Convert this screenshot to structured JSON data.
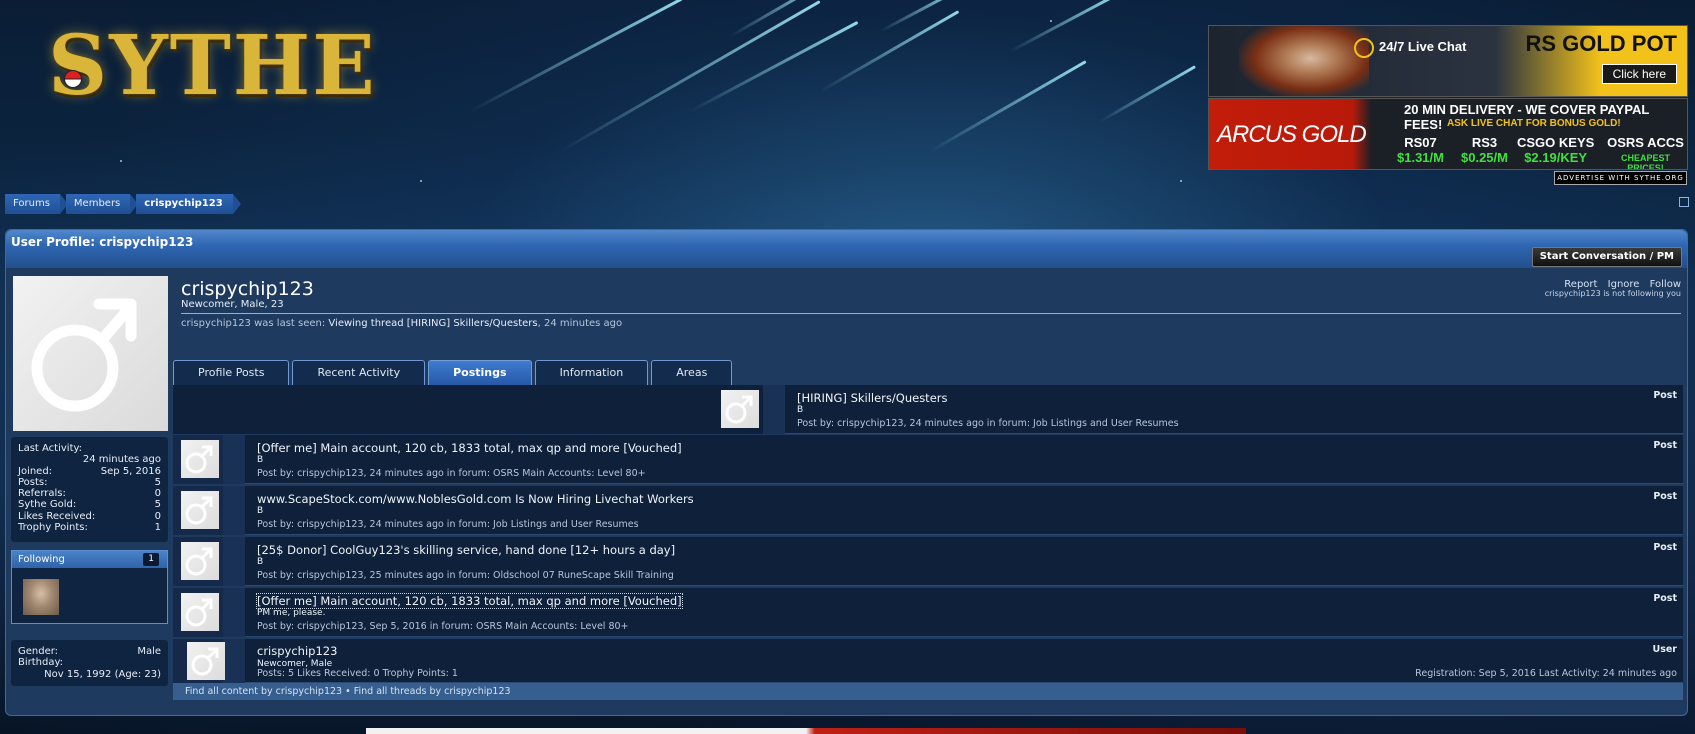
{
  "site": {
    "logo": "SYTHE"
  },
  "ads": {
    "top": {
      "livechat": "24/7 Live Chat",
      "brand": "RS GOLD POT",
      "cta": "Click here"
    },
    "mid": {
      "brand": "ARCUS GOLD",
      "headline": "20 MIN DELIVERY - WE COVER PAYPAL FEES!",
      "sub": "ASK LIVE CHAT FOR BONUS GOLD!",
      "items": [
        {
          "name": "RS07",
          "price": "$1.31/M"
        },
        {
          "name": "RS3",
          "price": "$0.25/M"
        },
        {
          "name": "CSGO KEYS",
          "price": "$2.19/KEY"
        },
        {
          "name": "OSRS ACCS",
          "price": "CHEAPEST PRICES!"
        }
      ]
    },
    "advertise": "ADVERTISE WITH SYTHE.ORG"
  },
  "breadcrumb": [
    "Forums",
    "Members",
    "crispychip123"
  ],
  "panel": {
    "title": "User Profile: crispychip123",
    "pm_button": "Start Conversation / PM"
  },
  "profile": {
    "username": "crispychip123",
    "usertitle": "Newcomer, Male, 23",
    "lastseen_prefix": "crispychip123 was last seen:",
    "lastseen_link": "Viewing thread [HIRING] Skillers/Questers",
    "lastseen_suffix": ", 24 minutes ago",
    "links": {
      "report": "Report",
      "ignore": "Ignore",
      "follow": "Follow"
    },
    "follow_note": "crispychip123 is not following you"
  },
  "stats": [
    {
      "label": "Last Activity:",
      "value": ""
    },
    {
      "label": "",
      "value": "24 minutes ago"
    },
    {
      "label": "Joined:",
      "value": "Sep 5, 2016"
    },
    {
      "label": "Posts:",
      "value": "5"
    },
    {
      "label": "Referrals:",
      "value": "0"
    },
    {
      "label": "Sythe Gold:",
      "value": "5"
    },
    {
      "label": "Likes Received:",
      "value": "0"
    },
    {
      "label": "Trophy Points:",
      "value": "1"
    }
  ],
  "following": {
    "label": "Following",
    "count": "1"
  },
  "info": {
    "gender_label": "Gender:",
    "gender": "Male",
    "birthday_label": "Birthday:",
    "birthday": "Nov 15, 1992 (Age: 23)"
  },
  "tabs": [
    "Profile Posts",
    "Recent Activity",
    "Postings",
    "Information",
    "Areas"
  ],
  "postings": [
    {
      "title": "[HIRING] Skillers/Questers",
      "snippet": "B",
      "meta": "Post by: crispychip123, 24 minutes ago in forum: Job Listings and User Resumes",
      "type": "Post"
    },
    {
      "title": "[Offer me] Main account, 120 cb, 1833 total, max qp and more [Vouched]",
      "snippet": "B",
      "meta": "Post by: crispychip123, 24 minutes ago in forum: OSRS Main Accounts: Level 80+",
      "type": "Post"
    },
    {
      "title": "www.ScapeStock.com/www.NoblesGold.com Is Now Hiring Livechat Workers",
      "snippet": "B",
      "meta": "Post by: crispychip123, 24 minutes ago in forum: Job Listings and User Resumes",
      "type": "Post"
    },
    {
      "title": "[25$ Donor] CoolGuy123's skilling service, hand done [12+ hours a day]",
      "snippet": "B",
      "meta": "Post by: crispychip123, 25 minutes ago in forum: Oldschool 07 RuneScape Skill Training",
      "type": "Post"
    },
    {
      "title": "[Offer me] Main account, 120 cb, 1833 total, max qp and more [Vouched]",
      "snippet": "PM me, please.",
      "meta": "Post by: crispychip123, Sep 5, 2016 in forum: OSRS Main Accounts: Level 80+",
      "type": "Post"
    }
  ],
  "user_result": {
    "name": "crispychip123",
    "title": "Newcomer, Male",
    "meta": "Posts: 5 Likes Received: 0 Trophy Points: 1",
    "right_meta": "Registration: Sep 5, 2016 Last Activity: 24 minutes ago",
    "type": "User"
  },
  "footer_links": "Find all content by crispychip123 • Find all threads by crispychip123"
}
